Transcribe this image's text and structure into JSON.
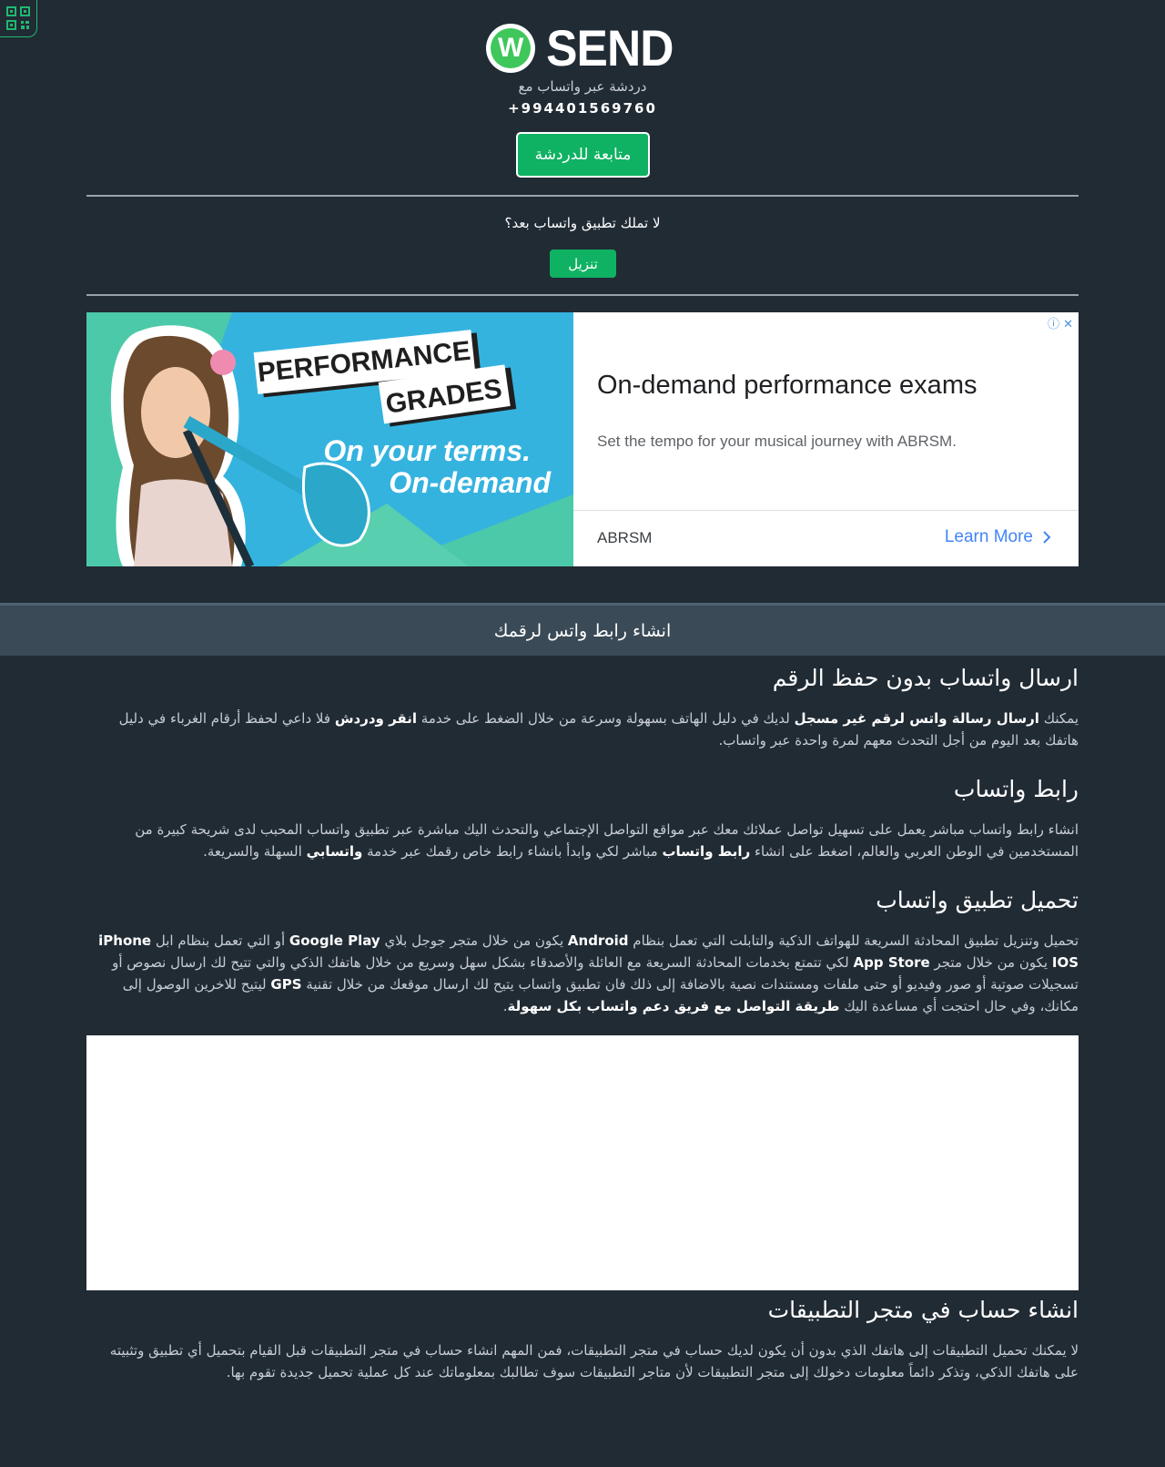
{
  "header": {
    "logo_letter": "W",
    "logo_text": "SEND",
    "subtitle": "دردشة عبر واتساب مع",
    "phone": "+994401569760",
    "continue_label": "متابعة للدردشة",
    "no_app_text": "لا تملك تطبيق واتساب بعد؟",
    "download_label": "تنزيل"
  },
  "ad": {
    "banner_line1": "PERFORMANCE",
    "banner_line2": "GRADES",
    "banner_line3": "On your terms.",
    "banner_line4": "On-demand",
    "choice_icons": "ⓘ ✕",
    "headline": "On-demand performance exams",
    "description": "Set the tempo for your musical journey with ABRSM.",
    "brand": "ABRSM",
    "cta": "Learn More"
  },
  "section_title": "انشاء رابط واتس لرقمك",
  "articles": [
    {
      "heading": "ارسال واتساب بدون حفظ الرقم",
      "parts": [
        "يمكنك ",
        "ارسال رسالة واتس لرقم غير مسجل",
        " لديك في دليل الهاتف بسهولة وسرعة من خلال الضغط على خدمة ",
        "انقر ودردش",
        " فلا داعي لحفظ أرقام الغرباء في دليل هاتفك بعد اليوم من أجل التحدث معهم لمرة واحدة عبر واتساب."
      ]
    },
    {
      "heading": "رابط واتساب",
      "parts": [
        "انشاء رابط واتساب مباشر يعمل على تسهيل تواصل عملائك معك عبر مواقع التواصل الإجتماعي والتحدث اليك مباشرة عبر تطبيق واتساب المحبب لدى شريحة كبيرة من المستخدمين في الوطن العربي والعالم، اضغط على انشاء ",
        "رابط واتساب",
        " مباشر لكي وابدأ بانشاء رابط خاص رقمك عبر خدمة ",
        "واتسابي",
        " السهلة والسريعة."
      ]
    },
    {
      "heading": "تحميل تطبيق واتساب",
      "parts": [
        "تحميل وتنزيل تطبيق المحادثة السريعة للهواتف الذكية والتابلت التي تعمل بنظام ",
        "Android",
        " يكون من خلال متجر جوجل بلاي ",
        "Google Play",
        " أو التي تعمل بنظام ابل ",
        "iPhone IOS",
        " يكون من خلال متجر ",
        "App Store",
        " لكي تتمتع بخدمات المحادثة السريعة مع العائلة والأصدقاء بشكل سهل وسريع من خلال هاتفك الذكي والتي تتيح لك ارسال نصوص أو تسجيلات صوتية أو صور وفيديو أو حتى ملفات ومستندات نصية بالاضافة إلى ذلك فان تطبيق واتساب يتيح لك ارسال موقعك من خلال تقنية ",
        "GPS",
        " ليتيح للاخرين الوصول إلى مكانك، وفي حال احتجت أي مساعدة اليك ",
        "طريقة التواصل مع فريق دعم واتساب بكل سهولة",
        "."
      ]
    },
    {
      "heading": "انشاء حساب في متجر التطبيقات",
      "parts": [
        "لا يمكنك تحميل التطبيقات إلى هاتفك الذي بدون أن يكون لديك حساب في متجر التطبيقات، فمن المهم انشاء حساب في متجر التطبيقات قبل القيام بتحميل أي تطبيق وتثبيته على هاتفك الذكي، وتذكر دائماً معلومات دخولك إلى متجر التطبيقات لأن متاجر التطبيقات سوف تطالبك بمعلوماتك عند كل عملية تحميل جديدة تقوم بها."
      ]
    }
  ],
  "colors": {
    "background": "#212b34",
    "accent_green": "#0fb262",
    "section_bar": "#3a4a57",
    "ad_link": "#4285f4"
  }
}
